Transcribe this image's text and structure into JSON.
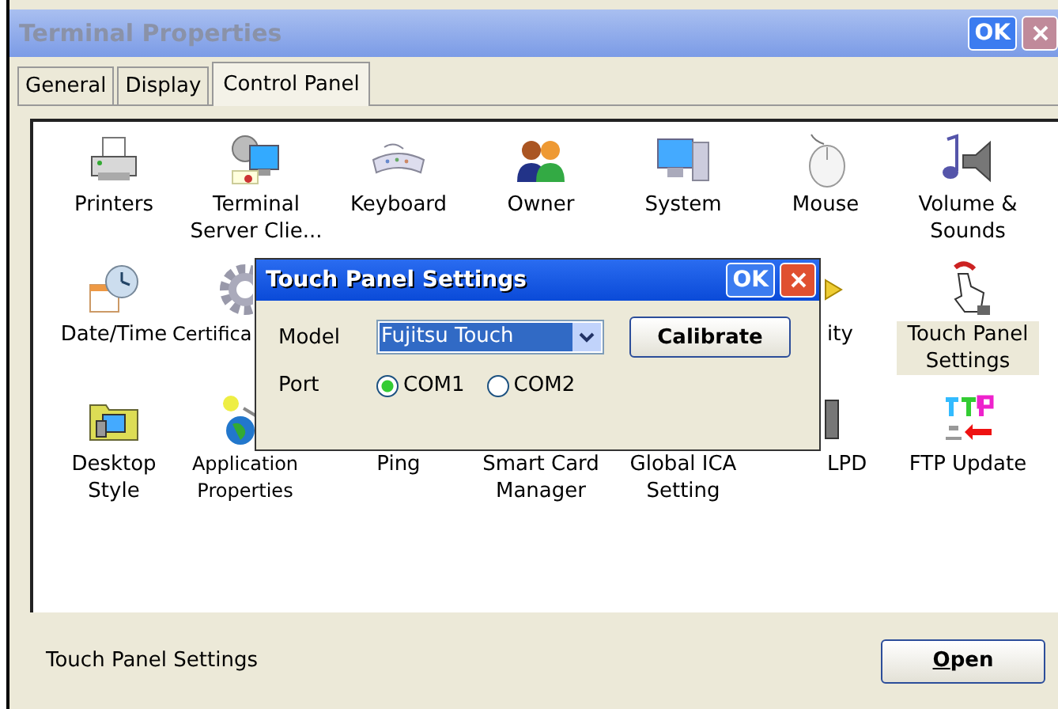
{
  "window": {
    "title": "Terminal Properties",
    "buttons": [
      "OK"
    ]
  },
  "tabs": [
    {
      "label": "General",
      "selected": false
    },
    {
      "label": "Display",
      "selected": false
    },
    {
      "label": "Control Panel",
      "selected": true
    }
  ],
  "items": [
    {
      "label": "Printers",
      "selected": false
    },
    {
      "label": "Terminal Server Clie...",
      "selected": false
    },
    {
      "label": "Keyboard",
      "selected": false
    },
    {
      "label": "Owner",
      "selected": false
    },
    {
      "label": "System",
      "selected": false
    },
    {
      "label": "Mouse",
      "selected": false
    },
    {
      "label": "Volume & Sounds",
      "selected": false
    },
    {
      "label": "Date/Time",
      "selected": false
    },
    {
      "label": "Certifica",
      "selected": false
    },
    {
      "label": "ity",
      "selected": false
    },
    {
      "label": "Touch Panel Settings",
      "selected": true
    },
    {
      "label": "Desktop Style",
      "selected": false
    },
    {
      "label": "Application Properties",
      "selected": false
    },
    {
      "label": "Ping",
      "selected": false
    },
    {
      "label": "Smart Card Manager",
      "selected": false
    },
    {
      "label": "Global ICA Setting",
      "selected": false
    },
    {
      "label": "LPD",
      "selected": false
    },
    {
      "label": "FTP Update",
      "selected": false
    }
  ],
  "dialog": {
    "title": "Touch Panel Settings",
    "ok": "OK",
    "model_label": "Model",
    "model_value": "Fujitsu Touch",
    "calibrate": "Calibrate",
    "port_label": "Port",
    "ports": [
      {
        "label": "COM1",
        "selected": true
      },
      {
        "label": "COM2",
        "selected": false
      }
    ]
  },
  "status": "Touch Panel Settings",
  "open_button": "Open"
}
